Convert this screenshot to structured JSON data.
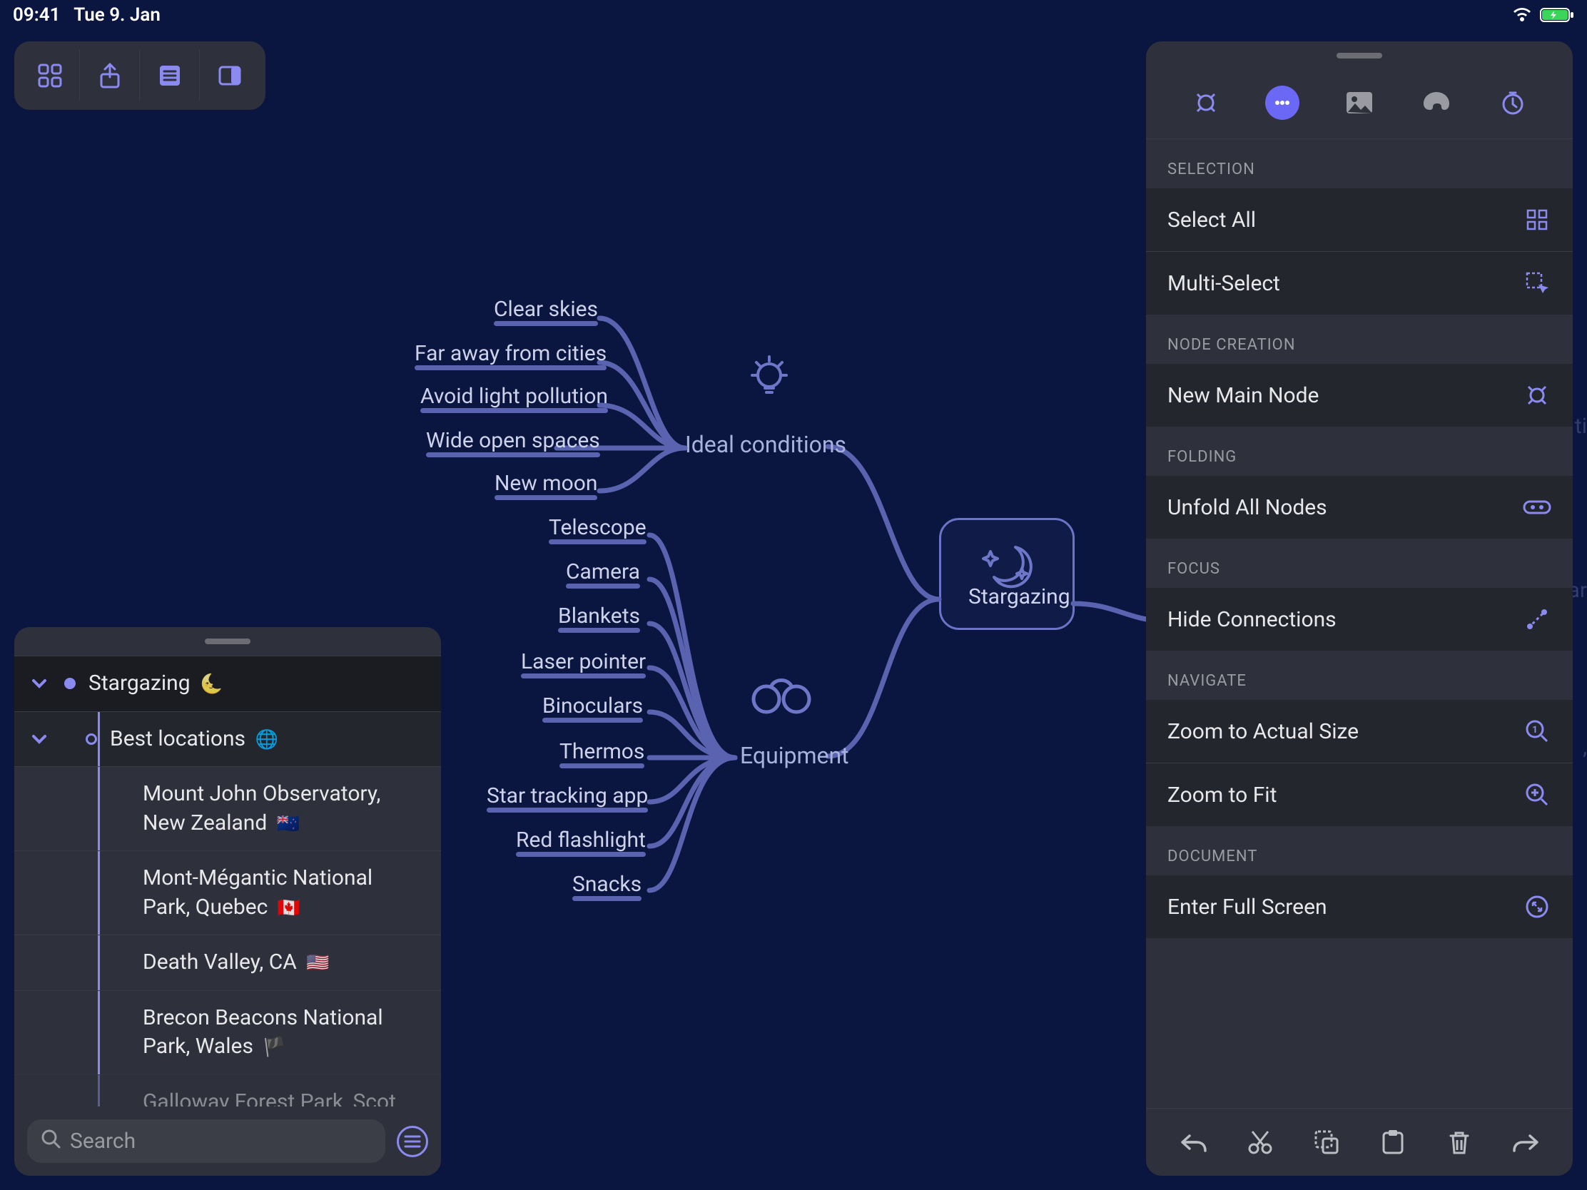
{
  "status": {
    "time": "09:41",
    "date": "Tue 9. Jan"
  },
  "search": {
    "placeholder": "Search"
  },
  "outline": {
    "root": {
      "label": "Stargazing",
      "emoji": "🌜"
    },
    "branch": {
      "label": "Best locations",
      "emoji": "🌐"
    },
    "items": [
      {
        "label": "Mount John Observatory, New Zealand",
        "flag": "🇳🇿"
      },
      {
        "label": "Mont-Mégantic National Park, Quebec",
        "flag": "🇨🇦"
      },
      {
        "label": "Death Valley, CA",
        "flag": "🇺🇸"
      },
      {
        "label": "Brecon Beacons National Park, Wales",
        "flag": "🏴"
      },
      {
        "label": "Galloway Forest Park, Scot",
        "flag": ""
      }
    ]
  },
  "mindmap": {
    "root": "Stargazing",
    "branches": [
      {
        "label": "Ideal conditions",
        "children": [
          "Clear skies",
          "Far away from cities",
          "Avoid light pollution",
          "Wide open spaces",
          "New moon"
        ]
      },
      {
        "label": "Equipment",
        "children": [
          "Telescope",
          "Camera",
          "Blankets",
          "Laser pointer",
          "Binoculars",
          "Thermos",
          "Star tracking app",
          "Red flashlight",
          "Snacks"
        ]
      }
    ]
  },
  "inspector": {
    "sections": {
      "selection": {
        "title": "SELECTION",
        "items": [
          "Select All",
          "Multi-Select"
        ]
      },
      "node_creation": {
        "title": "NODE CREATION",
        "items": [
          "New Main Node"
        ]
      },
      "folding": {
        "title": "FOLDING",
        "items": [
          "Unfold All Nodes"
        ]
      },
      "focus": {
        "title": "FOCUS",
        "items": [
          "Hide Connections"
        ]
      },
      "navigate": {
        "title": "NAVIGATE",
        "items": [
          "Zoom to Actual Size",
          "Zoom to Fit"
        ]
      },
      "document": {
        "title": "DOCUMENT",
        "items": [
          "Enter Full Screen"
        ]
      }
    }
  }
}
